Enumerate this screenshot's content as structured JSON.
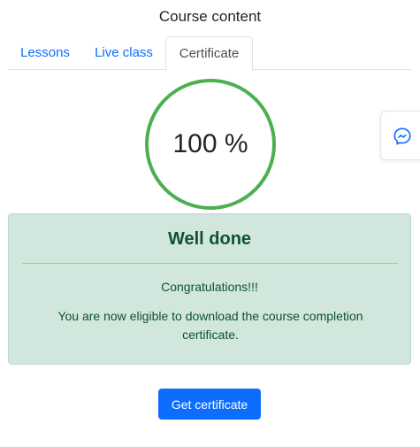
{
  "panel": {
    "title": "Course content"
  },
  "tabs": [
    {
      "label": "Lessons",
      "active": false
    },
    {
      "label": "Live class",
      "active": false
    },
    {
      "label": "Certificate",
      "active": true
    }
  ],
  "progress": {
    "value": 100,
    "label": "100 %"
  },
  "alert": {
    "heading": "Well done",
    "line1": "Congratulations!!!",
    "line2": "You are now eligible to download the course completion certificate."
  },
  "actions": {
    "get_certificate_label": "Get certificate"
  },
  "chat_widget": {
    "icon": "messenger-icon"
  },
  "colors": {
    "link": "#0d6efd",
    "progress_ring": "#4caf50",
    "alert_bg": "#d1e7dd",
    "alert_text": "#0f5132",
    "button_bg": "#0d6efd"
  }
}
